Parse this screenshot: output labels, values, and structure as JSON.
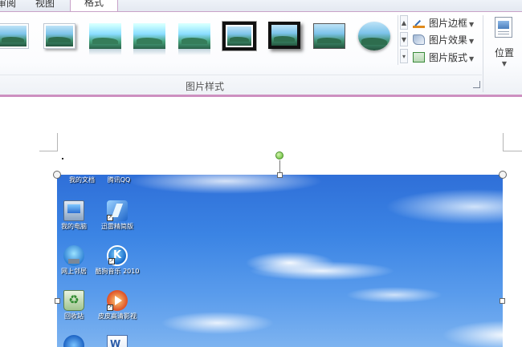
{
  "ribbon": {
    "tabs": [
      {
        "label": "审阅"
      },
      {
        "label": "视图"
      },
      {
        "label": "格式",
        "active": true
      }
    ],
    "picture_styles": {
      "group_label": "图片样式",
      "styles": [
        "简单框架，白色",
        "柔化边缘矩形",
        "双框架，黑色",
        "简单框架，黑色",
        "棱台亚光，白色",
        "映像圆角矩形",
        "金属框架",
        "矩形投影",
        "椭圆，柔化边缘"
      ],
      "commands": [
        {
          "label": "图片边框",
          "icon": "picture-border-icon"
        },
        {
          "label": "图片效果",
          "icon": "picture-effects-icon"
        },
        {
          "label": "图片版式",
          "icon": "picture-layout-icon"
        }
      ]
    },
    "arrange": {
      "position_label": "位置"
    },
    "accent_color": "#cd8fc0"
  },
  "document": {
    "desktop_icons": [
      {
        "label": "我的文档",
        "icon": "documents-icon"
      },
      {
        "label": "腾讯QQ",
        "icon": "qq-icon"
      },
      {
        "label": "我的电脑",
        "icon": "computer-icon"
      },
      {
        "label": "迅雷精简版",
        "icon": "thunder-icon"
      },
      {
        "label": "网上邻居",
        "icon": "network-icon"
      },
      {
        "label": "酷狗音乐 2010",
        "icon": "kugou-icon"
      },
      {
        "label": "回收站",
        "icon": "recycle-bin-icon"
      },
      {
        "label": "皮皮高清影视",
        "icon": "video-player-icon"
      },
      {
        "label": "",
        "icon": "ie-icon"
      },
      {
        "label": "",
        "icon": "word-icon"
      }
    ]
  }
}
